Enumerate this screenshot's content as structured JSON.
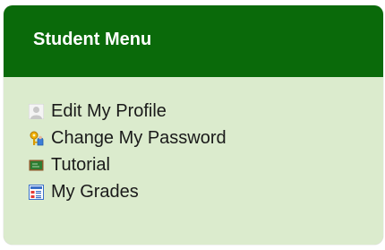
{
  "panel": {
    "title": "Student Menu",
    "header_color": "#0a6a0a",
    "body_color": "#dbebcd"
  },
  "menu": {
    "items": [
      {
        "label": "Edit My Profile",
        "icon": "user-profile-icon"
      },
      {
        "label": "Change My Password",
        "icon": "key-password-icon"
      },
      {
        "label": "Tutorial",
        "icon": "chalkboard-icon"
      },
      {
        "label": "My Grades",
        "icon": "gradebook-icon"
      }
    ]
  }
}
